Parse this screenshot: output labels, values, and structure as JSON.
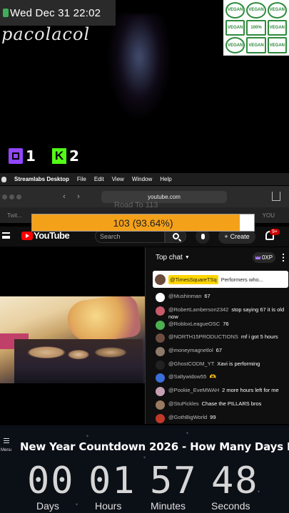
{
  "overlay": {
    "clock": "Wed Dec 31  22:02",
    "username": "pacolacol",
    "twitch_count": "1",
    "kick_count": "2",
    "kick_letter": "K",
    "vegan_badges": [
      "VEGAN",
      "VEGAN",
      "VEGAN",
      "VEGAN",
      "100%",
      "VEGAN",
      "VEGAN",
      "VEGAN",
      "VEGAN"
    ]
  },
  "menubar": {
    "app": "Streamlabs Desktop",
    "items": [
      "File",
      "Edit",
      "View",
      "Window",
      "Help"
    ]
  },
  "browser": {
    "url": "youtube.com",
    "tab_left": "Twit...",
    "tab_right": "YOU",
    "faded_title": "Road To 113"
  },
  "progress": {
    "label": "103 (93.64%)",
    "fraction": 0.9364
  },
  "youtube": {
    "logo": "YouTube",
    "search_placeholder": "Search",
    "create_label": "Create",
    "notif_badge": "9+"
  },
  "chat": {
    "header": "Top chat",
    "xp": "0XP",
    "pinned": {
      "name": "@TimesSquareTSq",
      "text": "Performers who..."
    },
    "messages": [
      {
        "name": "@Mushinman",
        "text": "67",
        "avatar_color": "#ffffff"
      },
      {
        "name": "@RobertLamberson2342",
        "text": "stop saying 67 it is old now",
        "avatar_color": "#c85a6a"
      },
      {
        "name": "@RobloxLeagueOSC",
        "text": "76",
        "avatar_color": "#4caf50"
      },
      {
        "name": "@NORTH15PRODUCTIONS",
        "text": "mf i got 5 hours",
        "avatar_color": "#6d4c41"
      },
      {
        "name": "@moneymagnetlol",
        "text": "67",
        "avatar_color": "#8e7a6a"
      },
      {
        "name": "@GhostCODM_YT",
        "text": "Xavi is performing",
        "avatar_color": "#222222"
      },
      {
        "name": "@Saltywidow55",
        "text": "🫶",
        "avatar_color": "#3a6fd8"
      },
      {
        "name": "@Pookie_EveMWAH",
        "text": "2 more hours left for me",
        "avatar_color": "#c8a0b4"
      },
      {
        "name": "@StuPickles",
        "text": "Chase the PILLARS bros",
        "avatar_color": "#9a7a60"
      },
      {
        "name": "@GothBigWorld",
        "text": "99",
        "avatar_color": "#c0392b"
      }
    ]
  },
  "countdown": {
    "menu_label": "Menu",
    "title": "New Year Countdown 2026 - How Many Days Le",
    "days": "00",
    "hours": "01",
    "minutes": "57",
    "seconds": "48",
    "days_label": "Days",
    "hours_label": "Hours",
    "minutes_label": "Minutes",
    "seconds_label": "Seconds"
  }
}
